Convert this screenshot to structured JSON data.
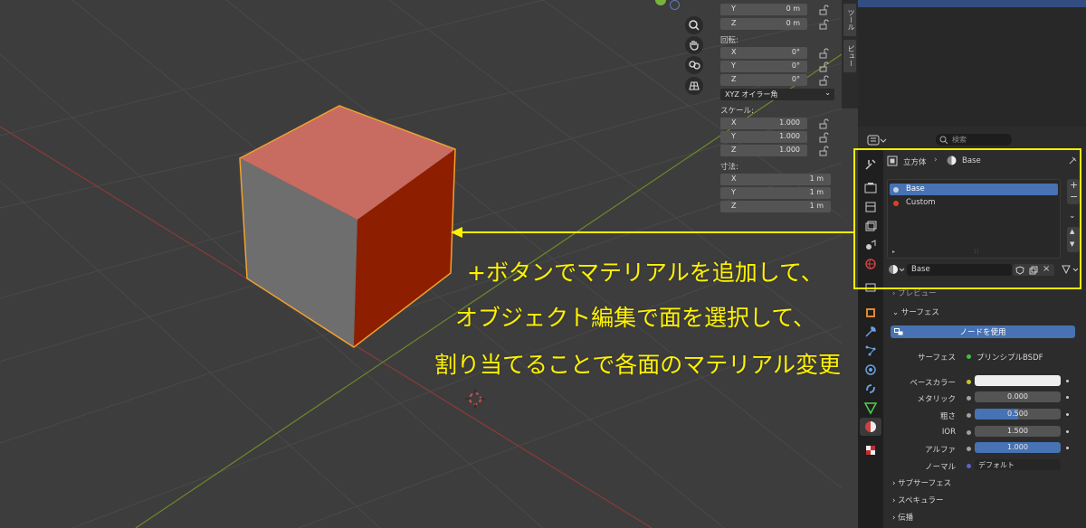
{
  "viewport": {
    "location_axes": [
      {
        "axis": "Y",
        "value": "0 m"
      },
      {
        "axis": "Z",
        "value": "0 m"
      }
    ],
    "rotation_title": "回転:",
    "rotation_axes": [
      {
        "axis": "X",
        "value": "0°"
      },
      {
        "axis": "Y",
        "value": "0°"
      },
      {
        "axis": "Z",
        "value": "0°"
      }
    ],
    "rotation_mode": "XYZ オイラー角",
    "scale_title": "スケール:",
    "scale_axes": [
      {
        "axis": "X",
        "value": "1.000"
      },
      {
        "axis": "Y",
        "value": "1.000"
      },
      {
        "axis": "Z",
        "value": "1.000"
      }
    ],
    "dimensions_title": "寸法:",
    "dimension_axes": [
      {
        "axis": "X",
        "value": "1 m"
      },
      {
        "axis": "Y",
        "value": "1 m"
      },
      {
        "axis": "Z",
        "value": "1 m"
      }
    ]
  },
  "side_tabs": [
    "ツール",
    "ビュー"
  ],
  "properties": {
    "search_placeholder": "検索",
    "breadcrumb_object": "立方体",
    "breadcrumb_material": "Base",
    "material_slots": [
      {
        "name": "Base",
        "color": "#c8d0e0"
      },
      {
        "name": "Custom",
        "color": "#e04020"
      }
    ],
    "material_name": "Base",
    "preview_label": "プレビュー",
    "surface_section": "サーフェス",
    "use_nodes_label": "ノードを使用",
    "surface_label": "サーフェス",
    "surface_value": "プリンシプルBSDF",
    "base_color_label": "ベースカラー",
    "metallic_label": "メタリック",
    "metallic_value": "0.000",
    "roughness_label": "粗さ",
    "roughness_value": "0.500",
    "roughness_fraction": 0.5,
    "ior_label": "IOR",
    "ior_value": "1.500",
    "alpha_label": "アルファ",
    "alpha_value": "1.000",
    "normal_label": "ノーマル",
    "normal_value": "デフォルト",
    "subsurface_section": "サブサーフェス",
    "specular_section": "スペキュラー",
    "transmission_section": "伝播"
  },
  "annotation": {
    "line1": "+ボタンでマテリアルを追加して、",
    "line2": "オブジェクト編集で面を選択して、",
    "line3": "割り当てることで各面のマテリアル変更",
    "color": "#fff200"
  },
  "colors": {
    "cube_top": "#c86b60",
    "cube_left": "#6e6e6e",
    "cube_right": "#8e1e00",
    "selection_outline": "#f0a030",
    "accent_blue": "#4772b3"
  }
}
